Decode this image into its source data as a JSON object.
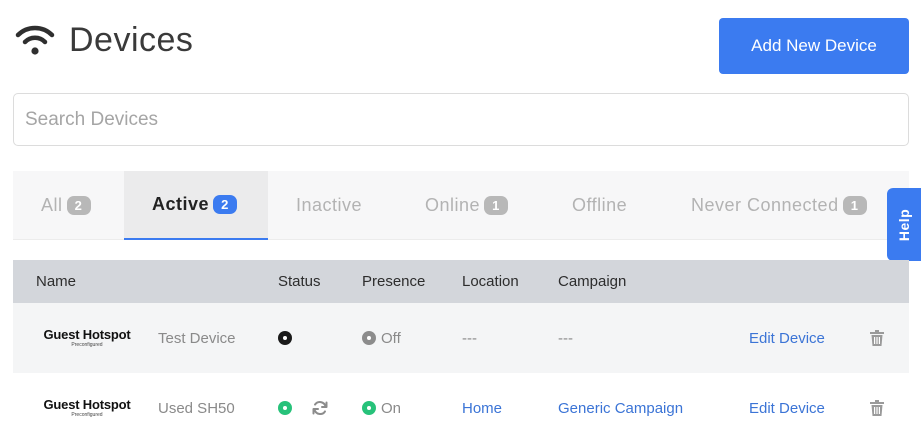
{
  "header": {
    "title": "Devices",
    "icon": "wifi-icon"
  },
  "actions": {
    "add_device_label": "Add New Device"
  },
  "search": {
    "placeholder": "Search Devices",
    "value": ""
  },
  "tabs": [
    {
      "label": "All",
      "count": "2",
      "active": false
    },
    {
      "label": "Active",
      "count": "2",
      "active": true
    },
    {
      "label": "Inactive",
      "count": null,
      "active": false
    },
    {
      "label": "Online",
      "count": "1",
      "active": false
    },
    {
      "label": "Offline",
      "count": null,
      "active": false
    },
    {
      "label": "Never Connected",
      "count": "1",
      "active": false
    }
  ],
  "help": {
    "label": "Help"
  },
  "table": {
    "columns": [
      "Name",
      "Status",
      "Presence",
      "Location",
      "Campaign"
    ],
    "rows": [
      {
        "brand": "Guest Hotspot",
        "brand_sub": "Preconfigured",
        "name": "Test Device",
        "status": "offline",
        "presence": "Off",
        "location": "---",
        "campaign": "---",
        "edit_label": "Edit Device"
      },
      {
        "brand": "Guest Hotspot",
        "brand_sub": "Preconfigured",
        "name": "Used SH50",
        "status": "online",
        "presence": "On",
        "location": "Home",
        "campaign": "Generic Campaign",
        "edit_label": "Edit Device"
      }
    ]
  },
  "colors": {
    "accent": "#3b7bf0",
    "online": "#27c27a",
    "link": "#3b74d6"
  }
}
